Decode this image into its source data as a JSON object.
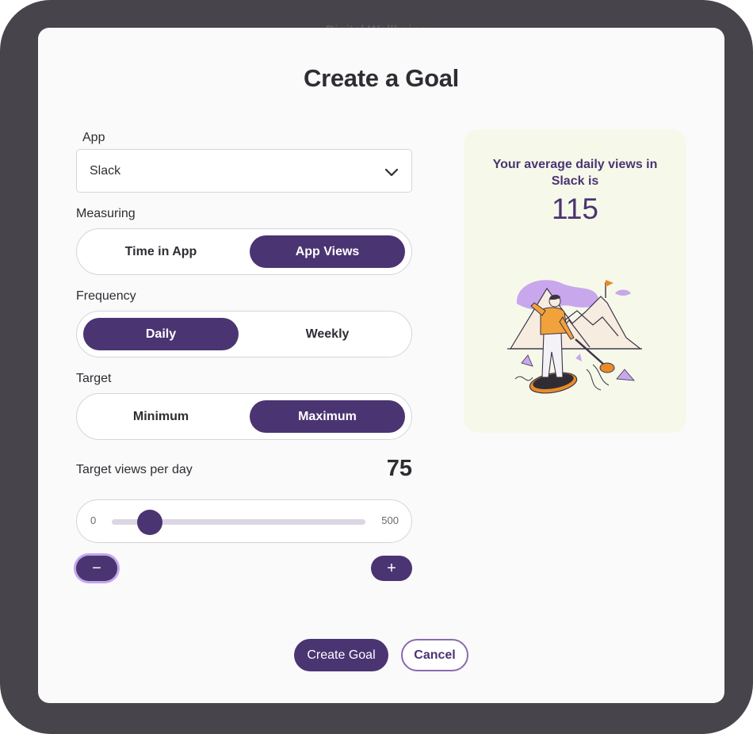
{
  "background": {
    "title": "Digital Wellbeing"
  },
  "dialog": {
    "title": "Create a Goal",
    "app": {
      "label": "App",
      "value": "Slack"
    },
    "measuring": {
      "label": "Measuring",
      "options": [
        "Time in App",
        "App Views"
      ],
      "selected": "App Views"
    },
    "frequency": {
      "label": "Frequency",
      "options": [
        "Daily",
        "Weekly"
      ],
      "selected": "Daily"
    },
    "target": {
      "label": "Target",
      "options": [
        "Minimum",
        "Maximum"
      ],
      "selected": "Maximum"
    },
    "target_views": {
      "label": "Target views per day",
      "value": "75"
    },
    "slider": {
      "min_label": "0",
      "max_label": "500",
      "min": 0,
      "max": 500,
      "value": 75
    },
    "stepper": {
      "minus": "−",
      "plus": "+"
    },
    "info_card": {
      "text": "Your average daily views in Slack is",
      "value": "115"
    },
    "buttons": {
      "create": "Create Goal",
      "cancel": "Cancel"
    }
  },
  "colors": {
    "accent": "#4b3472",
    "card_background": "#f6f9ea",
    "focus_ring": "#c3a6ee"
  }
}
